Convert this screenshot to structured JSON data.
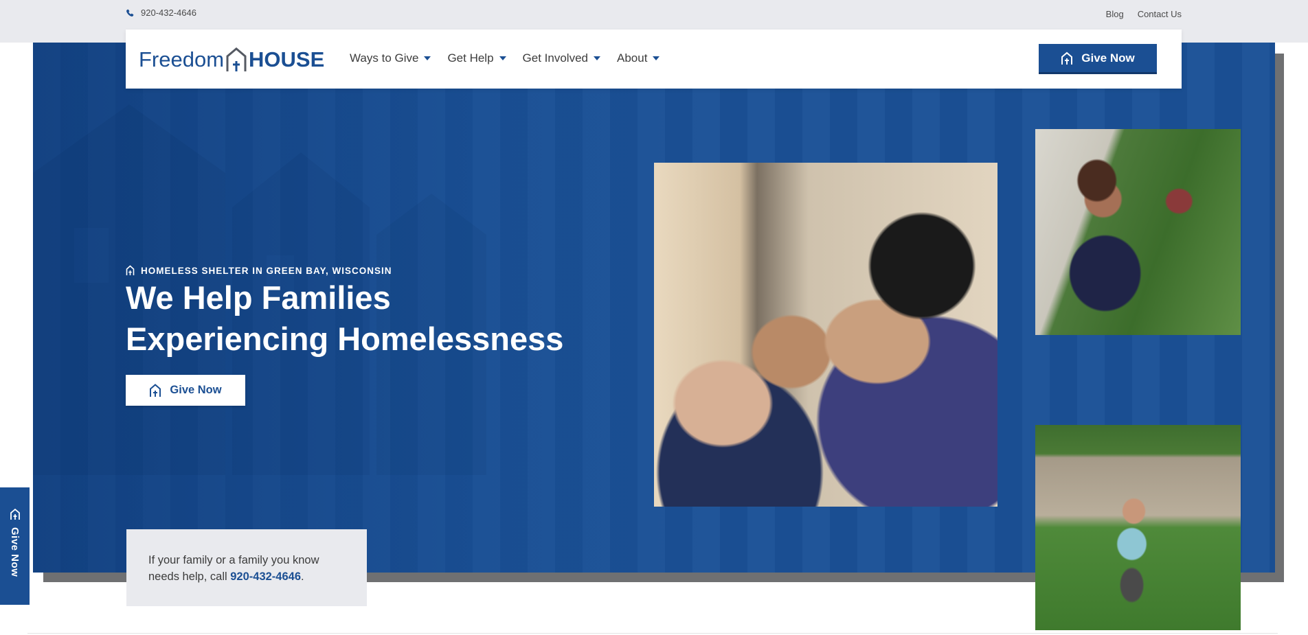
{
  "topbar": {
    "phone": "920-432-4646",
    "links": [
      "Blog",
      "Contact Us"
    ]
  },
  "logo": {
    "part1": "Freedom",
    "part2": "HOUSE"
  },
  "nav": {
    "items": [
      "Ways to Give",
      "Get Help",
      "Get Involved",
      "About"
    ],
    "give_button": "Give Now"
  },
  "hero": {
    "eyebrow": "HOMELESS SHELTER IN GREEN BAY, WISCONSIN",
    "headline_line1": "We Help Families",
    "headline_line2": "Experiencing Homelessness",
    "give_button": "Give Now"
  },
  "help": {
    "text_before": "If your family or a family you know needs help, call ",
    "phone": "920-432-4646",
    "text_after": "."
  },
  "side_tab": {
    "label": "Give Now"
  },
  "colors": {
    "brand_blue": "#1b4f93",
    "hero_blue": "#1b5197",
    "light_gray": "#e9eaee",
    "shadow_gray": "#6f7072"
  }
}
